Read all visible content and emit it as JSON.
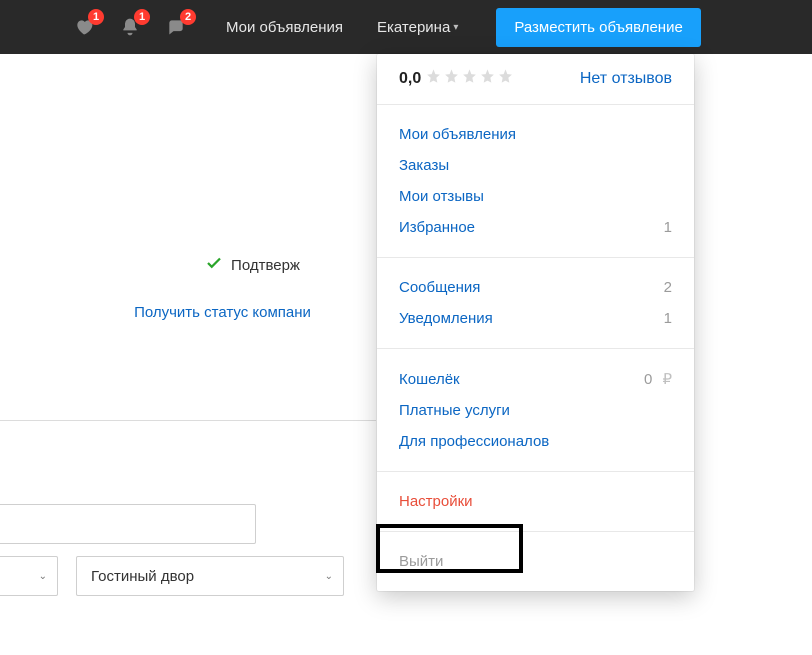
{
  "topbar": {
    "badges": {
      "favorites": "1",
      "notifications": "1",
      "messages": "2"
    },
    "my_ads": "Мои объявления",
    "username": "Екатерина",
    "post_button": "Разместить объявление"
  },
  "body": {
    "confirmed": "Подтверж",
    "company_status": "Получить статус компани",
    "metro_value": "Гостиный двор"
  },
  "dropdown": {
    "rating_value": "0,0",
    "no_reviews": "Нет отзывов",
    "menu1": {
      "my_ads": "Мои объявления",
      "orders": "Заказы",
      "my_reviews": "Мои отзывы",
      "favorites_label": "Избранное",
      "favorites_count": "1"
    },
    "menu2": {
      "messages_label": "Сообщения",
      "messages_count": "2",
      "notifications_label": "Уведомления",
      "notifications_count": "1"
    },
    "menu3": {
      "wallet_label": "Кошелёк",
      "wallet_amount": "0",
      "wallet_currency": "₽",
      "paid_services": "Платные услуги",
      "for_pros": "Для профессионалов"
    },
    "settings": "Настройки",
    "logout": "Выйти"
  }
}
